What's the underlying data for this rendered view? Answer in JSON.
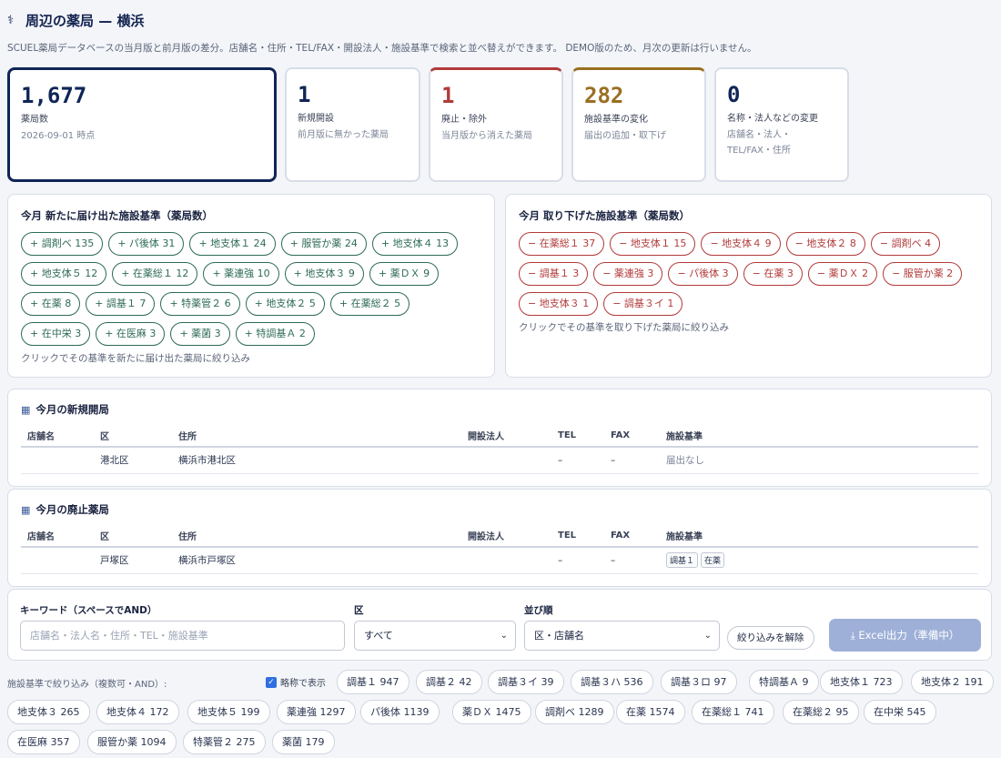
{
  "header": {
    "icon": "pharmacy-icon",
    "title": "周辺の薬局 — 横浜",
    "subtitle": "SCUEL薬局データベースの当月版と前月版の差分。店舗名・住所・TEL/FAX・開設法人・施設基準で検索と並べ替えができます。 DEMO版のため、月次の更新は行いません。"
  },
  "stats": [
    {
      "value": "1,677",
      "label": "薬局数",
      "sub": "2026-09-01 時点"
    },
    {
      "value": "1",
      "label": "新規開設",
      "sub": "前月版に無かった薬局"
    },
    {
      "value": "1",
      "label": "廃止・除外",
      "sub": "当月版から消えた薬局"
    },
    {
      "value": "282",
      "label": "施設基準の変化",
      "sub": "届出の追加・取下げ"
    },
    {
      "value": "0",
      "label": "名称・法人などの変更",
      "sub": "店舗名・法人・",
      "sub2": "TEL/FAX・住所"
    }
  ],
  "added": {
    "title": "今月 新たに届け出た施設基準（薬局数）",
    "chips": [
      "+ 調剤ベ 135",
      "+ パ後体 31",
      "+ 地支体１ 24",
      "+ 服管か薬 24",
      "+ 地支体４ 13",
      "+ 地支体５ 12",
      "+ 在薬総１ 12",
      "+ 薬連強 10",
      "+ 地支体３ 9",
      "+ 薬ＤＸ 9",
      "+ 在薬 8",
      "+ 調基１ 7",
      "+ 特薬管２ 6",
      "+ 地支体２ 5",
      "+ 在薬総２ 5",
      "+ 在中栄 3",
      "+ 在医麻 3",
      "+ 薬菌 3",
      "+ 特調基Ａ 2"
    ],
    "hint": "クリックでその基準を新たに届け出た薬局に絞り込み"
  },
  "removed": {
    "title": "今月 取り下げた施設基準（薬局数）",
    "chips": [
      "− 在薬総１ 37",
      "− 地支体１ 15",
      "− 地支体４ 9",
      "− 地支体２ 8",
      "− 調剤ベ 4",
      "− 調基１ 3",
      "− 薬連強 3",
      "− パ後体 3",
      "− 在薬 3",
      "− 薬ＤＸ 2",
      "− 服管か薬 2",
      "− 地支体３ 1",
      "− 調基３イ 1"
    ],
    "hint": "クリックでその基準を取り下げた薬局に絞り込み"
  },
  "columns": [
    "店舗名",
    "区",
    "住所",
    "開設法人",
    "TEL",
    "FAX",
    "施設基準"
  ],
  "newSection": {
    "title": "今月の新規開局",
    "row": {
      "name": "",
      "ward": "港北区",
      "address": "横浜市港北区",
      "corp": "",
      "tel": "–",
      "fax": "–",
      "standards": "届出なし"
    }
  },
  "closedSection": {
    "title": "今月の廃止薬局",
    "row": {
      "name": "",
      "ward": "戸塚区",
      "address": "横浜市戸塚区",
      "corp": "",
      "tel": "–",
      "fax": "–",
      "tags": [
        "調基１",
        "在薬"
      ]
    }
  },
  "filters": {
    "keyword_label": "キーワード（スペースでAND）",
    "keyword_placeholder": "店舗名・法人名・住所・TEL・施設基準",
    "ward_label": "区",
    "ward_value": "すべて",
    "sort_label": "並び順",
    "sort_value": "区・店舗名",
    "clear_label": "絞り込みを解除",
    "excel_label": "Excel出力（準備中）"
  },
  "facility": {
    "label": "施設基準で絞り込み（複数可・AND）:",
    "abbr_label": "略称で表示",
    "abbr_checked": true,
    "chips": [
      "調基１ 947",
      "調基２ 42",
      "調基３イ 39",
      "調基３ハ 536",
      "調基３ロ 97",
      "特調基Ａ 9",
      "地支体１ 723",
      "地支体２ 191",
      "地支体３ 265",
      "地支体４ 172",
      "地支体５ 199",
      "薬連強 1297",
      "パ後体 1139",
      "薬ＤＸ 1475",
      "調剤ベ 1289",
      "在薬 1574",
      "在薬総１ 741",
      "在薬総２ 95",
      "在中栄 545",
      "在医麻 357",
      "服管か薬 1094",
      "特薬管２ 275",
      "薬菌 179"
    ]
  }
}
